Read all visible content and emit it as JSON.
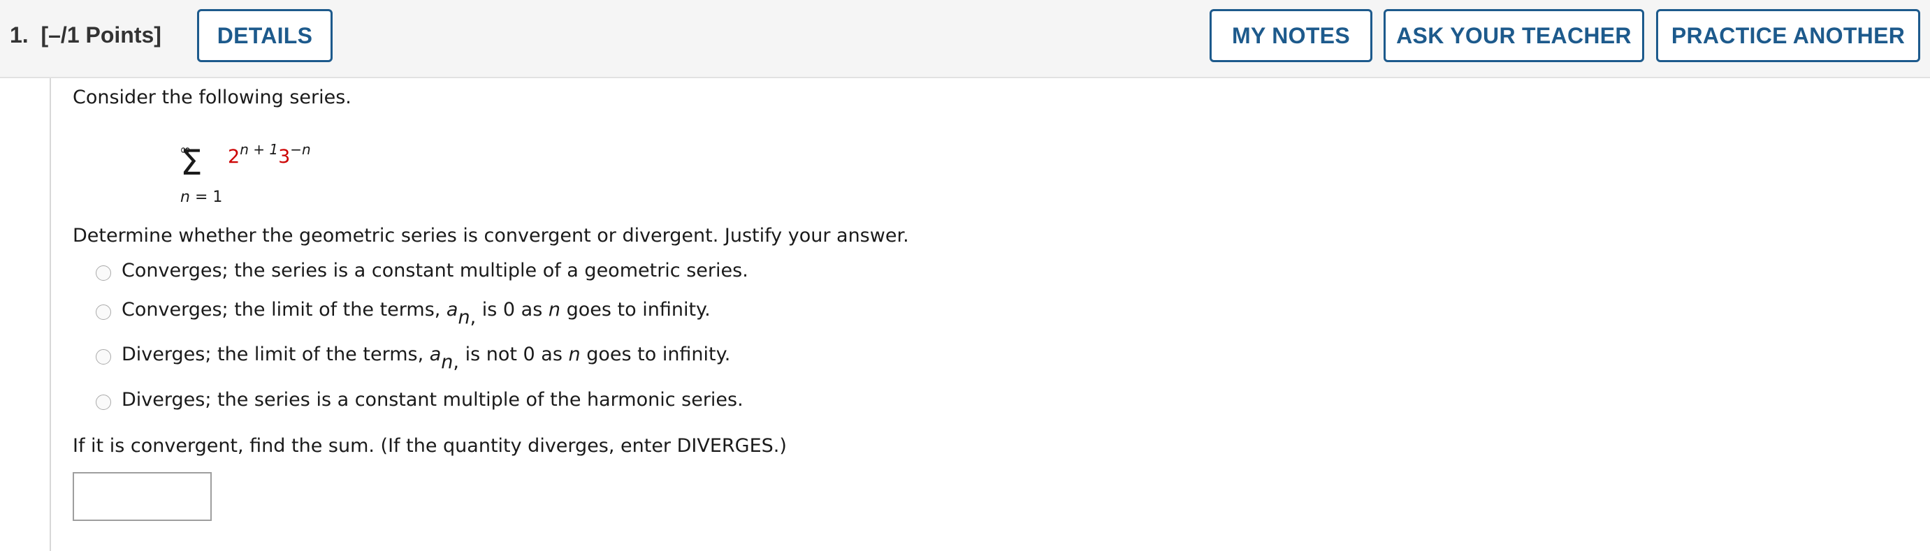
{
  "header": {
    "question_number": "1.",
    "points": "[–/1 Points]",
    "details_label": "DETAILS",
    "my_notes_label": "MY NOTES",
    "ask_teacher_label": "ASK YOUR TEACHER",
    "practice_another_label": "PRACTICE ANOTHER"
  },
  "problem": {
    "intro": "Consider the following series.",
    "series": {
      "upper_limit": "∞",
      "sigma": "Σ",
      "lower_var": "n",
      "lower_eq": " = 1",
      "base1": "2",
      "exp1": "n + 1",
      "base2": "3",
      "exp2": "−n"
    },
    "question": "Determine whether the geometric series is convergent or divergent. Justify your answer.",
    "options": [
      {
        "pre": "Converges; the series is a constant multiple of a geometric series."
      },
      {
        "pre": "Converges; the limit of the terms, ",
        "a": "a",
        "sub": "n",
        "comma": ",",
        "mid": " is 0 as ",
        "n": "n",
        "post": " goes to infinity."
      },
      {
        "pre": "Diverges; the limit of the terms, ",
        "a": "a",
        "sub": "n",
        "comma": ",",
        "mid": " is not 0 as ",
        "n": "n",
        "post": " goes to infinity."
      },
      {
        "pre": "Diverges; the series is a constant multiple of the harmonic series."
      }
    ],
    "sum_prompt": "If it is convergent, find the sum. (If the quantity diverges, enter DIVERGES.)",
    "answer_value": ""
  }
}
